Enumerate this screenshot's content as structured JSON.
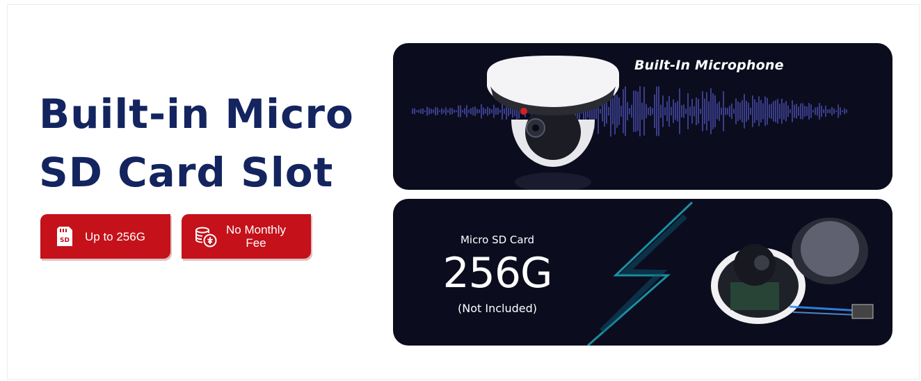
{
  "headline": {
    "line1": "Built-in Micro",
    "line2": "SD Card Slot"
  },
  "badges": [
    {
      "icon": "sd-card-icon",
      "label": "Up to 256G"
    },
    {
      "icon": "coins-icon",
      "label_line1": "No Monthly",
      "label_line2": "Fee"
    }
  ],
  "microphone_panel": {
    "title": "Built-In Microphone"
  },
  "sd_panel": {
    "caption": "Micro SD Card",
    "capacity": "256G",
    "note": "(Not Included)",
    "sd_chip_text": "SD"
  },
  "colors": {
    "headline": "#13245f",
    "badge": "#c4111a",
    "panel_bg": "#0b0c1e",
    "wave": "#5b63d8",
    "lightning": "#1fa7b8"
  }
}
